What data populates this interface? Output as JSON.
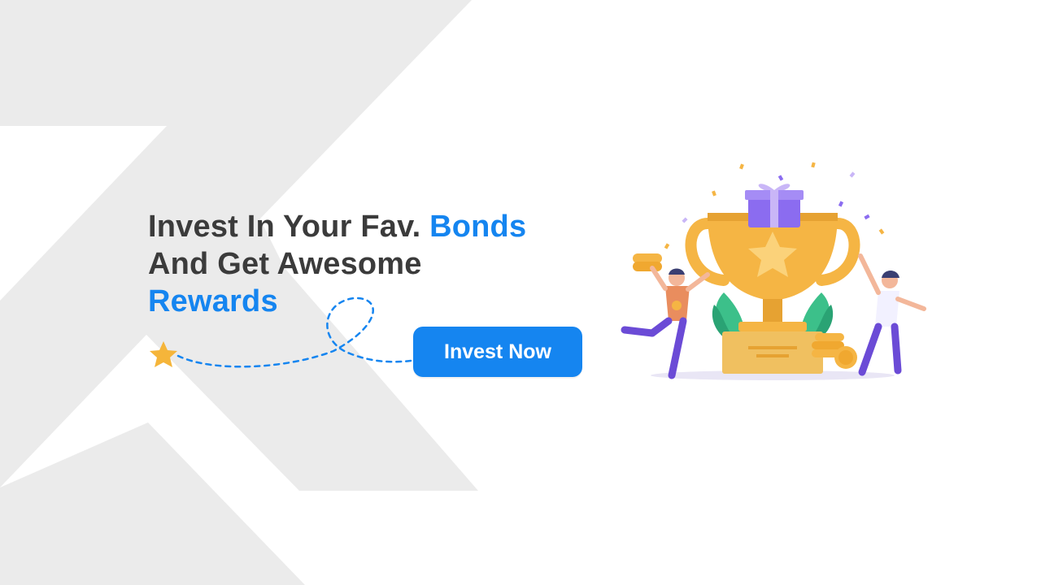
{
  "banner": {
    "headline_part1": "Invest In Your Fav. ",
    "headline_accent1": "Bonds",
    "headline_part2": "And Get Awesome",
    "headline_accent2": "Rewards",
    "cta_label": "Invest Now"
  },
  "colors": {
    "accent": "#1585f0",
    "text": "#3b3b3b",
    "background": "#ffffff",
    "shape_gray": "#ebebeb",
    "trophy_gold": "#f5b544",
    "gift_purple": "#8b6cf0"
  },
  "icons": [
    "star-icon",
    "dashed-path-icon",
    "trophy-illustration"
  ]
}
